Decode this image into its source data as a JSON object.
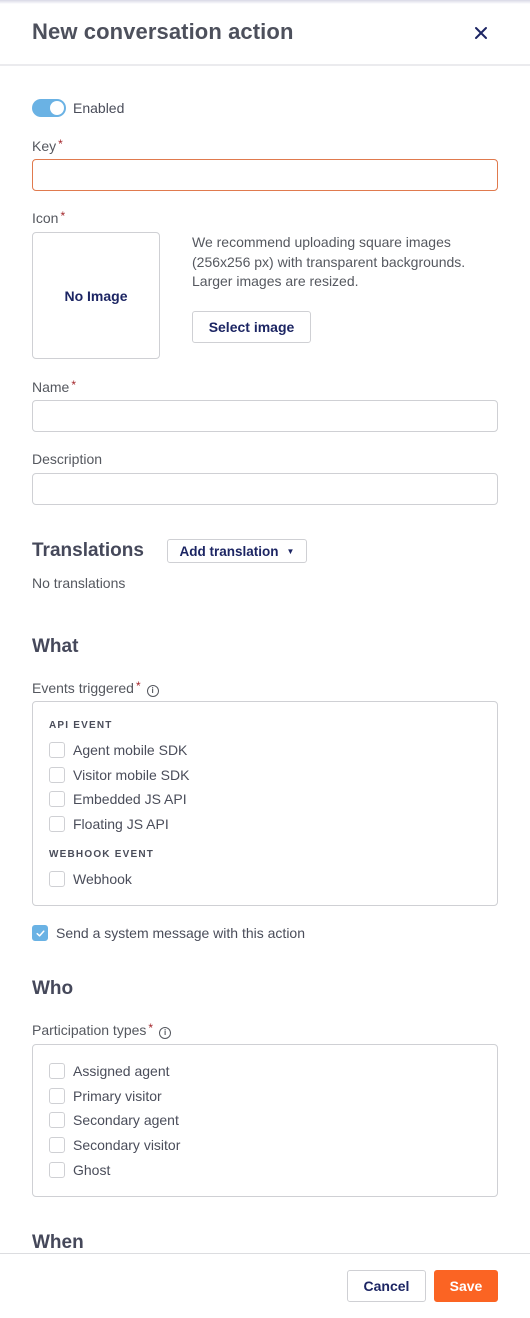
{
  "header": {
    "title": "New conversation action",
    "close_icon": "close-icon"
  },
  "form": {
    "enabled": {
      "label": "Enabled",
      "value": true
    },
    "key": {
      "label": "Key",
      "required_mark": "*",
      "value": "",
      "placeholder": ""
    },
    "icon": {
      "label": "Icon",
      "required_mark": "*",
      "preview_text": "No Image",
      "hint": "We recommend uploading square images (256x256 px) with transparent backgrounds. Larger images are resized.",
      "select_button": "Select image"
    },
    "name": {
      "label": "Name",
      "required_mark": "*",
      "value": "",
      "placeholder": ""
    },
    "description": {
      "label": "Description",
      "value": "",
      "placeholder": ""
    }
  },
  "translations": {
    "heading": "Translations",
    "add_button": "Add translation",
    "empty_text": "No translations"
  },
  "what": {
    "heading": "What",
    "events_label": "Events triggered",
    "required_mark": "*",
    "info_icon": "info-icon",
    "groups": [
      {
        "title": "API EVENT",
        "items": [
          {
            "label": "Agent mobile SDK",
            "checked": false
          },
          {
            "label": "Visitor mobile SDK",
            "checked": false
          },
          {
            "label": "Embedded JS API",
            "checked": false
          },
          {
            "label": "Floating JS API",
            "checked": false
          }
        ]
      },
      {
        "title": "WEBHOOK EVENT",
        "items": [
          {
            "label": "Webhook",
            "checked": false
          }
        ]
      }
    ],
    "system_message": {
      "label": "Send a system message with this action",
      "checked": true
    }
  },
  "who": {
    "heading": "Who",
    "participation_label": "Participation types",
    "required_mark": "*",
    "items": [
      {
        "label": "Assigned agent",
        "checked": false
      },
      {
        "label": "Primary visitor",
        "checked": false
      },
      {
        "label": "Secondary agent",
        "checked": false
      },
      {
        "label": "Secondary visitor",
        "checked": false
      },
      {
        "label": "Ghost",
        "checked": false
      }
    ]
  },
  "when": {
    "heading": "When"
  },
  "footer": {
    "cancel": "Cancel",
    "save": "Save"
  },
  "colors": {
    "accent": "#fb6423",
    "toggle_on": "#6ab2e4",
    "primary_text": "#1c2563",
    "error_border": "#e07a4e"
  }
}
